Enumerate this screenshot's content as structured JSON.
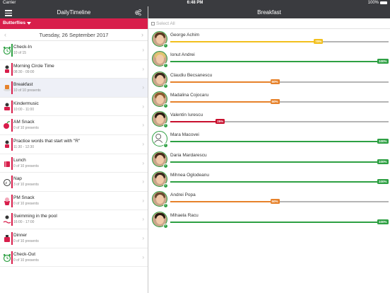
{
  "status_bar": {
    "carrier": "Carrier",
    "time": "6:48 PM",
    "battery": "100%"
  },
  "left": {
    "app_title": "DailyTimeline",
    "group": "Butterflies",
    "date": "Tuesday, 26 September 2017",
    "activities": [
      {
        "name": "Check-In",
        "sub": "10 of 15",
        "color": "#2ea043",
        "icon": "alarm-clock-icon",
        "selected": false
      },
      {
        "name": "Morning Circle Time",
        "sub": "08:30 - 09:00",
        "color": "#d81e4b",
        "icon": "kids-circle-icon",
        "selected": false
      },
      {
        "name": "Breakfast",
        "sub": "10 of 10 presents",
        "color": "#d81e4b",
        "icon": "breakfast-icon",
        "selected": true
      },
      {
        "name": "Kindermusic",
        "sub": "10:00 - 11:00",
        "color": "#d81e4b",
        "icon": "music-icon",
        "selected": false
      },
      {
        "name": "AM Snack",
        "sub": "0 of 10 presents",
        "color": "#d81e4b",
        "icon": "snack-icon",
        "selected": false
      },
      {
        "name": "Practice words that start with \"R\"",
        "sub": "11:30 - 12:30",
        "color": "#d81e4b",
        "icon": "letters-icon",
        "selected": false
      },
      {
        "name": "Lunch",
        "sub": "0 of 10 presents",
        "color": "#d81e4b",
        "icon": "lunch-icon",
        "selected": false
      },
      {
        "name": "Nap",
        "sub": "3 of 10 presents",
        "color": "#d81e4b",
        "icon": "nap-icon",
        "selected": false
      },
      {
        "name": "PM Snack",
        "sub": "0 of 10 presents",
        "color": "#d81e4b",
        "icon": "cupcake-icon",
        "selected": false
      },
      {
        "name": "Swimming in the pool",
        "sub": "16:00 - 17:00",
        "color": "#d81e4b",
        "icon": "swimming-icon",
        "selected": false
      },
      {
        "name": "Dinner",
        "sub": "0 of 10 presents",
        "color": "#d81e4b",
        "icon": "dinner-icon",
        "selected": false
      },
      {
        "name": "Check-Out",
        "sub": "0 of 10 presents",
        "color": "#d81e4b",
        "icon": "alarm-clock-icon",
        "selected": false
      }
    ]
  },
  "right": {
    "title": "Breakfast",
    "select_all": "Select All",
    "children": [
      {
        "name": "George Achim",
        "percent": 70,
        "label": "70%",
        "color": "#f2c01e",
        "avatar_hair": "#5b3a22"
      },
      {
        "name": "Ionut Andrei",
        "percent": 100,
        "label": "100%",
        "color": "#2ea043",
        "avatar_hair": "#e0c56e"
      },
      {
        "name": "Claudiu Becsanescu",
        "percent": 50,
        "label": "50%",
        "color": "#e6822b",
        "avatar_hair": "#3a2a1e"
      },
      {
        "name": "Madalina Cojocaru",
        "percent": 50,
        "label": "50%",
        "color": "#e6822b",
        "avatar_hair": "#8a5a2e"
      },
      {
        "name": "Valentin Iurescu",
        "percent": 25,
        "label": "25%",
        "color": "#c8102e",
        "avatar_hair": "#2b1d14"
      },
      {
        "name": "Mara Macovei",
        "percent": 100,
        "label": "100%",
        "color": "#2ea043",
        "avatar_hair": ""
      },
      {
        "name": "Daria Mardarescu",
        "percent": 100,
        "label": "100%",
        "color": "#2ea043",
        "avatar_hair": "#4a2e1c"
      },
      {
        "name": "Mihnea Oglodeanu",
        "percent": 100,
        "label": "100%",
        "color": "#2ea043",
        "avatar_hair": "#3b2b20"
      },
      {
        "name": "Andrei Popa",
        "percent": 50,
        "label": "50%",
        "color": "#e6822b",
        "avatar_hair": "#6b4a30"
      },
      {
        "name": "Mihaela Racu",
        "percent": 100,
        "label": "100%",
        "color": "#2ea043",
        "avatar_hair": "#2a1c12"
      }
    ]
  }
}
